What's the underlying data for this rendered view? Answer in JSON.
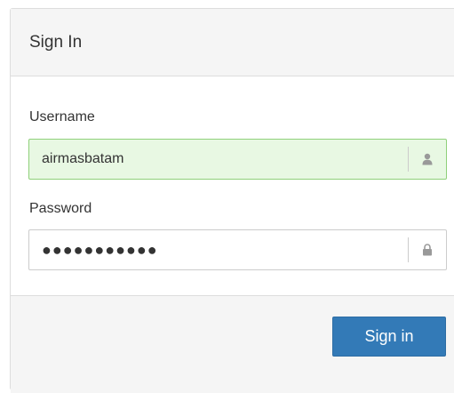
{
  "panel": {
    "title": "Sign In"
  },
  "form": {
    "username": {
      "label": "Username",
      "value": "airmasbatam",
      "icon": "user-icon"
    },
    "password": {
      "label": "Password",
      "value": "●●●●●●●●●●●",
      "icon": "lock-icon"
    }
  },
  "footer": {
    "signin_label": "Sign in"
  },
  "colors": {
    "accent": "#337ab7",
    "filled_background": "#e8f8e3",
    "filled_border": "#8fd07a",
    "heading_background": "#f5f5f5"
  }
}
